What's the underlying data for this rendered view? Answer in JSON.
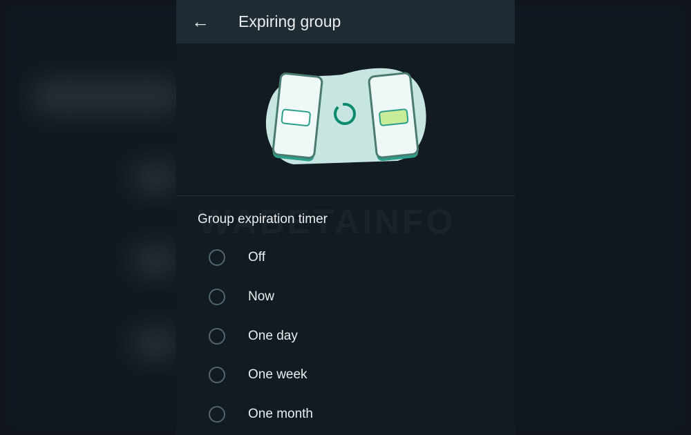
{
  "header": {
    "title": "Expiring group",
    "back_icon": "arrow-left-icon"
  },
  "illustration": {
    "name": "two-phones-timer-illustration",
    "accent": "#00a884"
  },
  "watermark": "WABETAINFO",
  "section_title": "Group expiration timer",
  "options": [
    {
      "label": "Off",
      "selected": false
    },
    {
      "label": "Now",
      "selected": false
    },
    {
      "label": "One day",
      "selected": false
    },
    {
      "label": "One week",
      "selected": false
    },
    {
      "label": "One month",
      "selected": false
    }
  ]
}
